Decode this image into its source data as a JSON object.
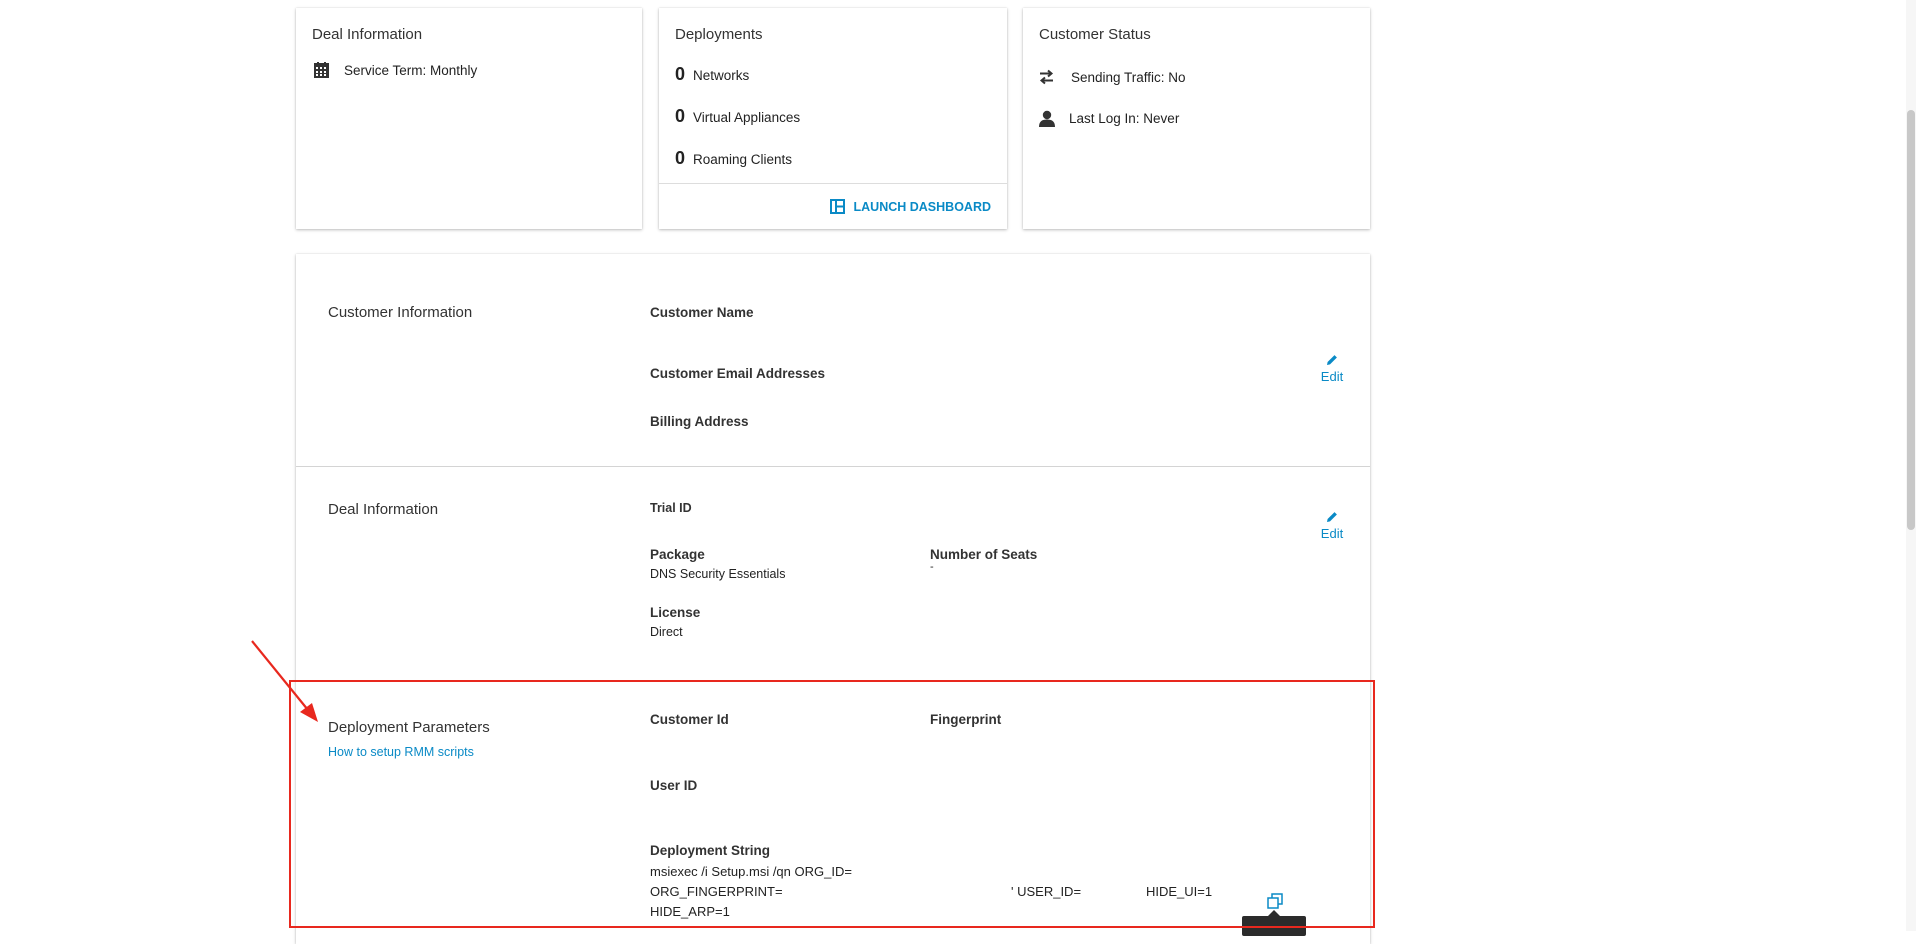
{
  "deal_card": {
    "title": "Deal Information",
    "service_term": "Service Term: Monthly"
  },
  "deployments_card": {
    "title": "Deployments",
    "rows": [
      {
        "count": "0",
        "label": "Networks"
      },
      {
        "count": "0",
        "label": "Virtual Appliances"
      },
      {
        "count": "0",
        "label": "Roaming Clients"
      }
    ],
    "launch_label": "LAUNCH DASHBOARD"
  },
  "status_card": {
    "title": "Customer Status",
    "sending_traffic": "Sending Traffic: No",
    "last_login": "Last Log In: Never"
  },
  "customer_info": {
    "title": "Customer Information",
    "name_label": "Customer Name",
    "email_label": "Customer Email Addresses",
    "billing_label": "Billing Address",
    "edit_label": "Edit"
  },
  "deal_info": {
    "title": "Deal Information",
    "trial_label": "Trial ID",
    "package_label": "Package",
    "package_value": "DNS Security Essentials",
    "seats_label": "Number of Seats",
    "seats_value": "-",
    "license_label": "License",
    "license_value": "Direct",
    "edit_label": "Edit"
  },
  "deployment_params": {
    "title": "Deployment Parameters",
    "rmm_link": "How to setup RMM scripts",
    "customer_id_label": "Customer Id",
    "fingerprint_label": "Fingerprint",
    "user_id_label": "User ID",
    "deployment_string_label": "Deployment String",
    "string_line1": "msiexec /i Setup.msi /qn ORG_ID=",
    "string_line2a": "ORG_FINGERPRINT=",
    "string_line2b": "' USER_ID=",
    "string_line2c": "HIDE_UI=1",
    "string_line3": "HIDE_ARP=1"
  },
  "colors": {
    "accent": "#0a8ac6",
    "annotation": "#e8281e"
  }
}
